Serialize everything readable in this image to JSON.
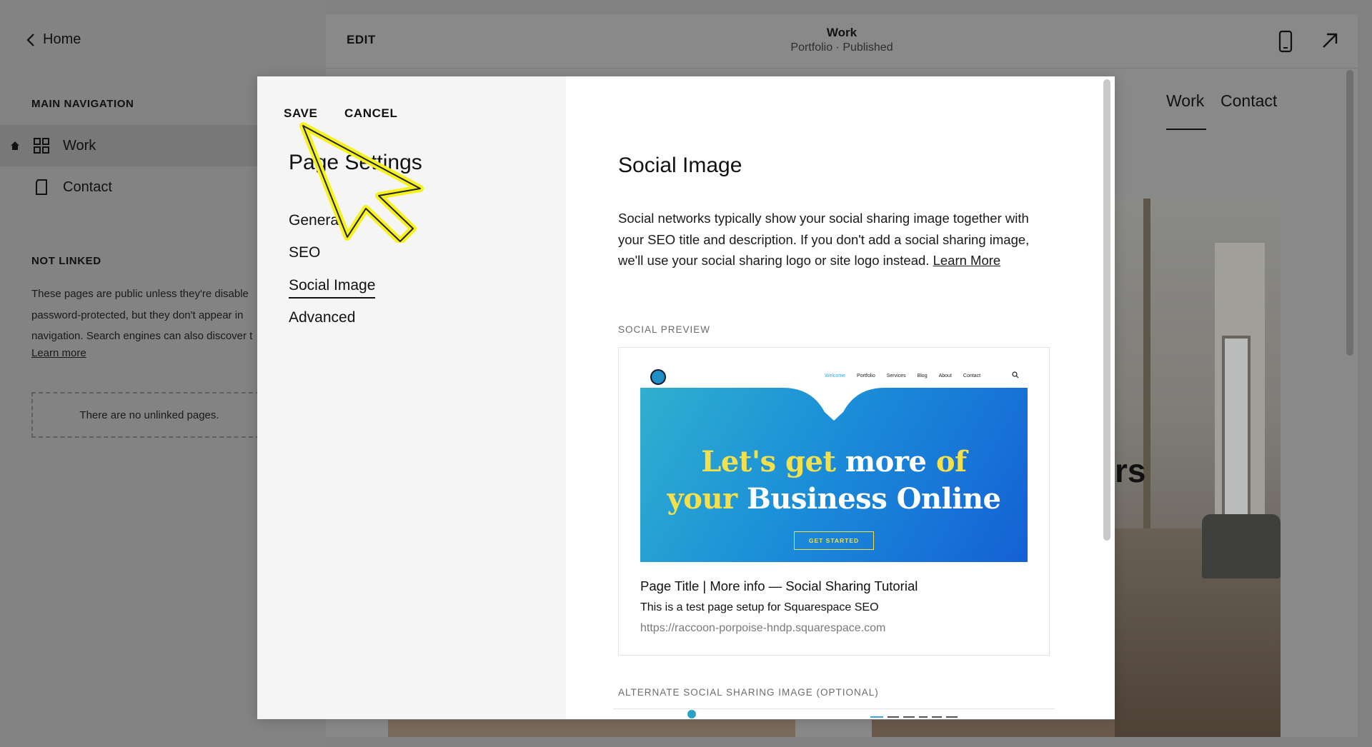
{
  "sidebar": {
    "home_label": "Home",
    "main_nav_title": "MAIN NAVIGATION",
    "main_nav_items": [
      {
        "label": "Work",
        "icon": "grid-icon",
        "active": true
      },
      {
        "label": "Contact",
        "icon": "page-icon",
        "active": false
      }
    ],
    "not_linked_title": "NOT LINKED",
    "not_linked_lines": [
      "These pages are public unless they're disable",
      "password-protected, but they don't appear in",
      "navigation. Search engines can also discover t"
    ],
    "learn_more": "Learn more",
    "empty_message": "There are no unlinked pages."
  },
  "editor": {
    "edit_label": "EDIT",
    "page_name": "Work",
    "page_status": "Portfolio · Published",
    "site_nav": [
      "Work",
      "Contact"
    ],
    "hero_fragment": "rs"
  },
  "modal": {
    "save_label": "SAVE",
    "cancel_label": "CANCEL",
    "title": "Page Settings",
    "menu": [
      {
        "label": "General",
        "active": false
      },
      {
        "label": "SEO",
        "active": false
      },
      {
        "label": "Social Image",
        "active": true
      },
      {
        "label": "Advanced",
        "active": false
      }
    ],
    "content": {
      "title": "Social Image",
      "description": "Social networks typically show your social sharing image together with your SEO title and description. If you don't add a social sharing image, we'll use your social sharing logo or site logo instead.",
      "learn_more": "Learn More",
      "social_preview_label": "SOCIAL PREVIEW",
      "alternate_label": "ALTERNATE SOCIAL SHARING IMAGE (OPTIONAL)"
    },
    "preview": {
      "nav": [
        "Welcome",
        "Portfolio",
        "Services",
        "Blog",
        "About",
        "Contact"
      ],
      "headline_line1": [
        "Let's get",
        "more",
        "of"
      ],
      "headline_line2": [
        "your",
        "Business Online"
      ],
      "button": "GET STARTED",
      "title": "Page Title | More info — Social Sharing Tutorial",
      "description": "This is a test page setup for Squarespace SEO",
      "url": "https://raccoon-porpoise-hndp.squarespace.com"
    }
  },
  "colors": {
    "overlay": "#828282",
    "modal_bg": "#ffffff",
    "modal_side_bg": "#f5f5f5",
    "banner_start": "#2fb0cf",
    "banner_end": "#1560d6",
    "headline_yellow": "#f4e04a",
    "cursor_yellow": "#f7f21c"
  }
}
